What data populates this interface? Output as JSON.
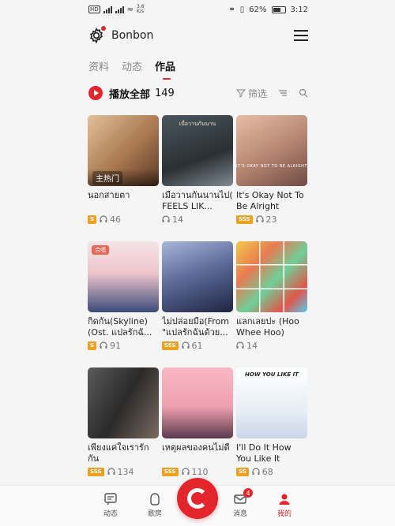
{
  "status_bar": {
    "left_small": "3.6\nK/s",
    "right_text": "62%",
    "time": "3:12"
  },
  "header": {
    "brand": "Bonbon",
    "settings_icon": "gear-icon",
    "menu_icon": "menu-icon"
  },
  "tabs": [
    {
      "label": "资料",
      "active": false
    },
    {
      "label": "动态",
      "active": false
    },
    {
      "label": "作品",
      "active": true
    }
  ],
  "playrow": {
    "play_all": "播放全部",
    "count": "149",
    "filter_label": "筛选"
  },
  "works": [
    {
      "title": "นอกสายตา",
      "level": "S",
      "plays": "46",
      "cover_tag": "",
      "cover_overlay": "主热门",
      "colors": [
        "#d8b38a",
        "#8a5c3d"
      ]
    },
    {
      "title": "เมื่อวานกันนานไป( FEELS LIK...",
      "level": "",
      "plays": "14",
      "cover_tag": "",
      "cover_overlay": "",
      "colors": [
        "#30363a",
        "#7b8790"
      ]
    },
    {
      "title": "It's Okay Not To Be Alright",
      "level": "SSS",
      "plays": "23",
      "cover_tag": "",
      "cover_overlay": "",
      "colors": [
        "#d7a78f",
        "#6f4c44"
      ]
    },
    {
      "title": "กิดกัน(Skyline)(Ost. แปลรักฉั...",
      "level": "S",
      "plays": "91",
      "cover_tag": "合唱",
      "cover_overlay": "",
      "colors": [
        "#f3d7dc",
        "#2a3a6a"
      ]
    },
    {
      "title": "ไม่ปล่อยมือ(From \"แปลรักฉันด้วย...",
      "level": "SSS",
      "plays": "61",
      "cover_tag": "",
      "cover_overlay": "",
      "colors": [
        "#8fa0c8",
        "#1e2540"
      ]
    },
    {
      "title": "แลกเลยปะ (Hoo Whee Hoo)",
      "level": "",
      "plays": "14",
      "cover_tag": "",
      "cover_overlay": "",
      "colors": [
        "#f2c94c",
        "#e0564a"
      ]
    },
    {
      "title": "เพียงแค่ใจเรารักกัน",
      "level": "SSS",
      "plays": "134",
      "cover_tag": "",
      "cover_overlay": "",
      "colors": [
        "#4a4a4a",
        "#1d1d1d"
      ]
    },
    {
      "title": "เหตุผลของคนไม่ดี",
      "level": "SSS",
      "plays": "110",
      "cover_tag": "",
      "cover_overlay": "",
      "colors": [
        "#f2a6b4",
        "#5a3a4a"
      ]
    },
    {
      "title": "I'll Do It How You Like It",
      "level": "SS",
      "plays": "68",
      "cover_tag": "",
      "cover_overlay": "",
      "colors": [
        "#ffffff",
        "#c9d6e8"
      ]
    }
  ],
  "cover_texts": {
    "c2": "เมื่อวานกันนาน",
    "c3": "IT'S OKAY NOT TO BE ALRIGHT",
    "c9": "HOW YOU LIKE IT"
  },
  "bottom_nav": [
    {
      "label": "动态",
      "icon": "feed-icon",
      "active": false
    },
    {
      "label": "歌房",
      "icon": "room-icon",
      "active": false
    },
    {
      "label": "",
      "icon": "record-icon",
      "active": false
    },
    {
      "label": "消息",
      "icon": "message-icon",
      "active": false,
      "badge": "4"
    },
    {
      "label": "我的",
      "icon": "profile-icon",
      "active": true
    }
  ],
  "accent": "#e4252b"
}
